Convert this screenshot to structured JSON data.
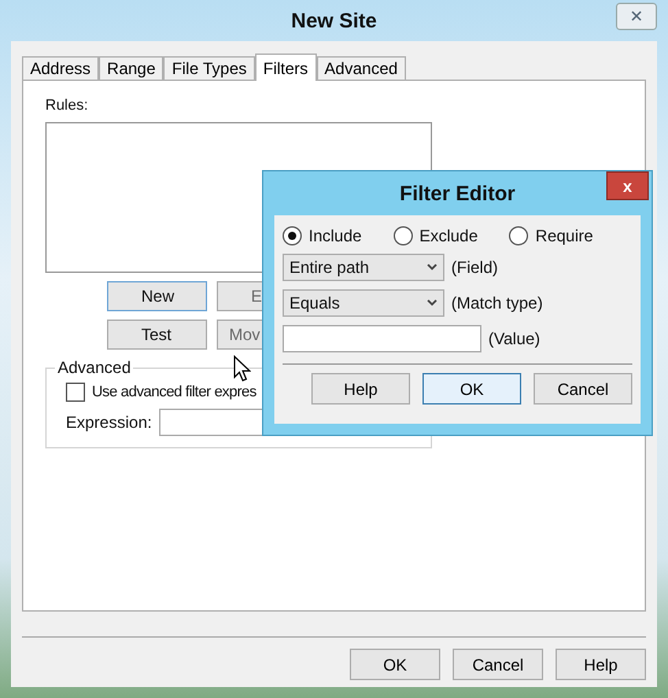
{
  "window": {
    "title": "New Site",
    "close": "✕"
  },
  "tabs": [
    {
      "label": "Address",
      "selected": false
    },
    {
      "label": "Range",
      "selected": false
    },
    {
      "label": "File Types",
      "selected": false
    },
    {
      "label": "Filters",
      "selected": true
    },
    {
      "label": "Advanced",
      "selected": false
    }
  ],
  "rules": {
    "label": "Rules:"
  },
  "rule_buttons": [
    {
      "label": "New",
      "focused": true,
      "disabled": false
    },
    {
      "label": "E",
      "focused": false,
      "disabled": true
    },
    {
      "label": "Test",
      "focused": false,
      "disabled": false
    },
    {
      "label": "Mov",
      "focused": false,
      "disabled": true
    }
  ],
  "advanced": {
    "title": "Advanced",
    "checkbox": {
      "label": "Use advanced filter expres",
      "checked": false
    },
    "expression_label": "Expression:"
  },
  "buttons": [
    {
      "label": "OK"
    },
    {
      "label": "Cancel"
    },
    {
      "label": "Help"
    }
  ],
  "filter_editor": {
    "title": "Filter Editor",
    "close": "x",
    "options": [
      {
        "label": "Include",
        "selected": true
      },
      {
        "label": "Exclude",
        "selected": false
      },
      {
        "label": "Require",
        "selected": false
      }
    ],
    "field": {
      "value": "Entire path",
      "hint": "(Field)"
    },
    "match_type": {
      "value": "Equals",
      "hint": "(Match type)"
    },
    "value_hint": "(Value)",
    "buttons": [
      {
        "label": "Help",
        "focused": false
      },
      {
        "label": "OK",
        "focused": true
      },
      {
        "label": "Cancel",
        "focused": false
      }
    ]
  }
}
